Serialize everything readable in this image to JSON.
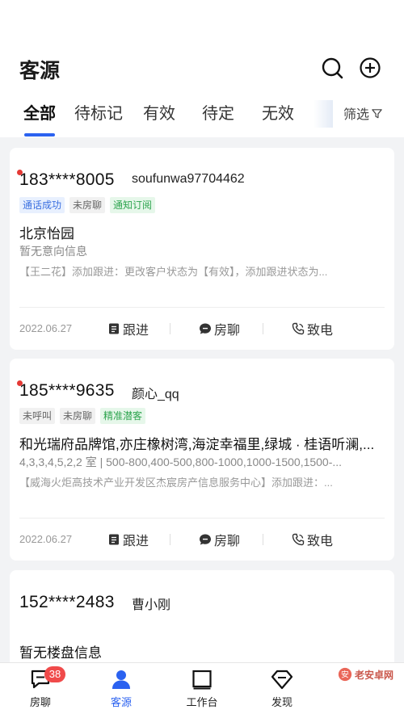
{
  "header": {
    "title": "客源",
    "search_icon": "search-icon",
    "add_icon": "plus-circle-icon"
  },
  "tabs": [
    {
      "label": "全部",
      "active": true
    },
    {
      "label": "待标记",
      "active": false
    },
    {
      "label": "有效",
      "active": false
    },
    {
      "label": "待定",
      "active": false
    },
    {
      "label": "无效",
      "active": false
    }
  ],
  "filter": {
    "label": "筛选",
    "icon": "funnel-icon"
  },
  "cards": [
    {
      "phone": "183****8005",
      "name": "soufunwa97704462",
      "unread": true,
      "tags": [
        {
          "text": "通话成功",
          "color": "blue"
        },
        {
          "text": "未房聊",
          "color": "gray"
        },
        {
          "text": "通知订阅",
          "color": "green"
        }
      ],
      "line1": "北京怡园",
      "line2": "暂无意向信息",
      "line3": "【王二花】添加跟进：更改客户状态为【有效】，添加跟进状态为...",
      "date": "2022.06.27",
      "actions": {
        "follow": "跟进",
        "chat": "房聊",
        "call": "致电"
      }
    },
    {
      "phone": "185****9635",
      "name": "颜心_qq",
      "unread": true,
      "tags": [
        {
          "text": "未呼叫",
          "color": "gray"
        },
        {
          "text": "未房聊",
          "color": "gray"
        },
        {
          "text": "精准潜客",
          "color": "green"
        }
      ],
      "line1": "和光瑞府品牌馆,亦庄橡树湾,海淀幸福里,绿城 · 桂语听澜,...",
      "line2": "4,3,3,4,5,2,2 室 | 500-800,400-500,800-1000,1000-1500,1500-...",
      "line3": "【威海火炬高技术产业开发区杰宸房产信息服务中心】添加跟进：...",
      "date": "2022.06.27",
      "actions": {
        "follow": "跟进",
        "chat": "房聊",
        "call": "致电"
      }
    },
    {
      "phone": "152****2483",
      "name": "曹小刚",
      "unread": false,
      "line1": "暂无楼盘信息"
    }
  ],
  "bottom_nav": [
    {
      "label": "房聊",
      "icon": "chat-icon",
      "badge": "38",
      "active": false
    },
    {
      "label": "客源",
      "icon": "person-icon",
      "active": true
    },
    {
      "label": "工作台",
      "icon": "workbench-icon",
      "active": false
    },
    {
      "label": "发现",
      "icon": "diamond-icon",
      "active": false
    }
  ],
  "watermark": "老安卓网",
  "colors": {
    "accent": "#2b62f0",
    "badge": "#f04a4a",
    "unread_dot": "#e53935"
  }
}
